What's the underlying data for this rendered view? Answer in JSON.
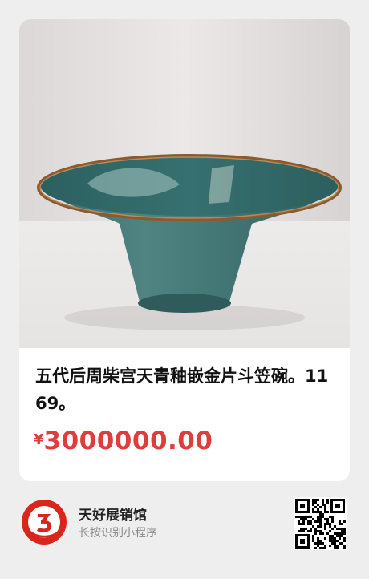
{
  "product": {
    "title": "五代后周柴宫天青釉嵌金片斗笠碗。1169。",
    "currency_symbol": "¥",
    "price": "3000000.00",
    "price_color": "#e03c3c"
  },
  "shop": {
    "name": "天好展销馆",
    "hint": "长按识别小程序",
    "logo_icon": "red-circle-3-logo"
  },
  "qr": {
    "icon": "mini-program-qr-code"
  }
}
